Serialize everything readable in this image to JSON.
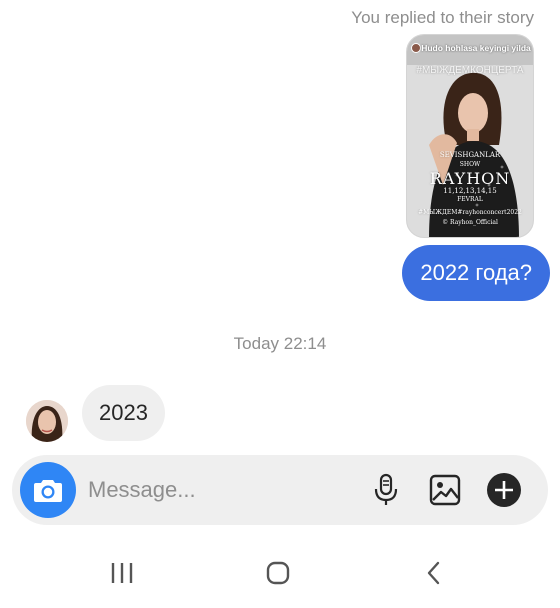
{
  "conversation": {
    "replied_label": "You replied to their story",
    "story": {
      "caption": "Hudo hohlasa keyingi yilda",
      "banner_text": "#МЫЖДЕМКОНЦЕРТА",
      "title_small": "SEVISHGANLAR",
      "show_label": "SHOW",
      "artist": "RAYHON",
      "dates": "11,12,13,14,15",
      "month": "FEVRAL",
      "hashtag": "#МЫЖДЁМ#rayhonconcert2022",
      "handle": "© Rayhon_Official"
    },
    "outgoing_message": "2022 года?",
    "timestamp": "Today 22:14",
    "incoming_message": "2023"
  },
  "composer": {
    "placeholder": "Message...",
    "icons": [
      "camera-icon",
      "microphone-icon",
      "gallery-icon",
      "plus-icon"
    ]
  },
  "navbar": {
    "icons": [
      "recent-apps-icon",
      "home-icon",
      "back-icon"
    ]
  },
  "colors": {
    "outgoing_bubble": "#3b6fe0",
    "incoming_bubble": "#efefef",
    "camera_button": "#2f86f5",
    "muted_text": "#8e8e8e"
  }
}
